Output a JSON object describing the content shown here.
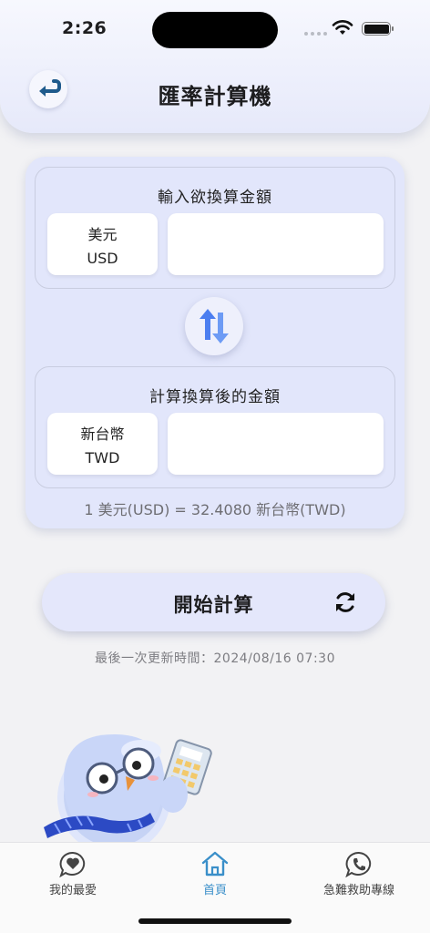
{
  "status": {
    "time": "2:26"
  },
  "header": {
    "title": "匯率計算機"
  },
  "converter": {
    "from": {
      "label": "輸入欲換算金額",
      "currency_name": "美元",
      "currency_code": "USD",
      "amount": ""
    },
    "to": {
      "label": "計算換算後的金額",
      "currency_name": "新台幣",
      "currency_code": "TWD",
      "amount": ""
    },
    "rate_text": "1 美元(USD) = 32.4080 新台幣(TWD)"
  },
  "actions": {
    "calculate_label": "開始計算"
  },
  "update_text": "最後一次更新時間：2024/08/16 07:30",
  "tabbar": {
    "tabs": [
      {
        "label": "我的最愛",
        "icon": "heart-chat-icon"
      },
      {
        "label": "首頁",
        "icon": "home-icon",
        "active": true
      },
      {
        "label": "急難救助專線",
        "icon": "phone-chat-icon"
      }
    ]
  },
  "colors": {
    "accent": "#3a8fc9",
    "card": "#e2e6fb",
    "swap_arrow": "#4b7ef0"
  }
}
